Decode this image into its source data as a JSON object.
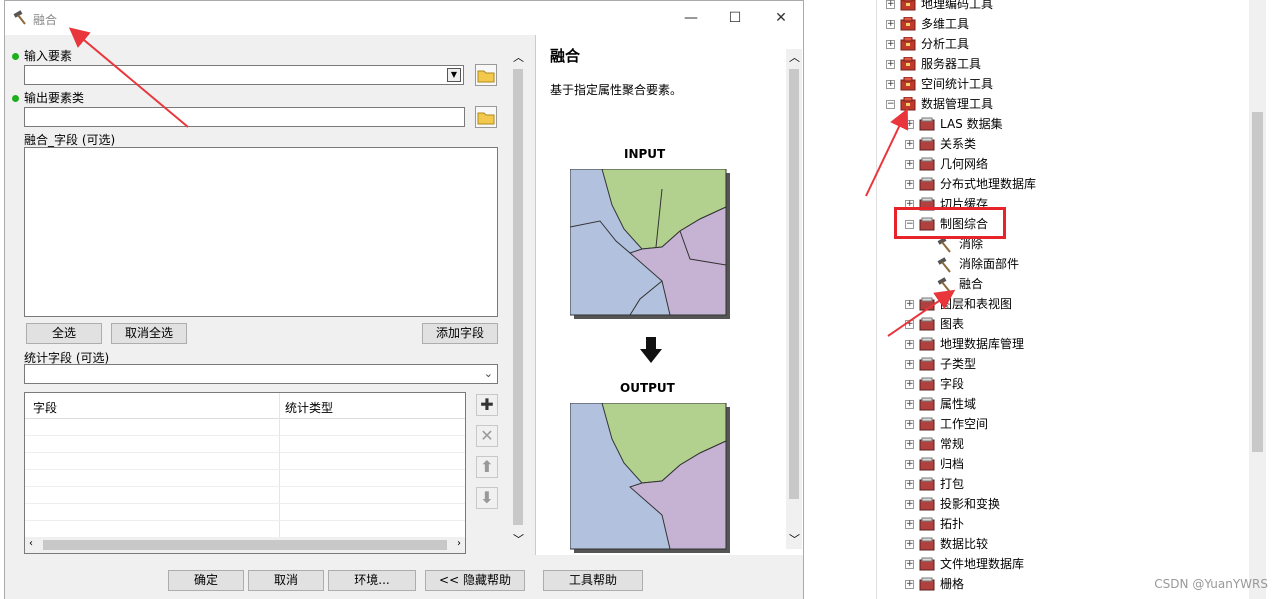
{
  "dialog": {
    "title": "融合",
    "controls": {
      "minimize": "—",
      "maximize": "☐",
      "close": "✕"
    },
    "input_features_label": "输入要素",
    "output_features_label": "输出要素类",
    "dissolve_field_label": "融合_字段 (可选)",
    "select_all": "全选",
    "clear_all": "取消全选",
    "add_field": "添加字段",
    "stat_field_label": "统计字段 (可选)",
    "stat_table": {
      "col_field": "字段",
      "col_stat_type": "统计类型"
    },
    "buttons": {
      "ok": "确定",
      "cancel": "取消",
      "env": "环境...",
      "hide_help": "<< 隐藏帮助",
      "tool_help": "工具帮助"
    }
  },
  "help": {
    "title": "融合",
    "description": "基于指定属性聚合要素。",
    "input_label": "INPUT",
    "output_label": "OUTPUT"
  },
  "colors": {
    "green": "#b3d18e",
    "blue": "#b2c1de",
    "purple": "#c6b3d4",
    "arrow": "#e8363c",
    "highlight": "#e8242b"
  },
  "tree": {
    "items": [
      {
        "label": "地理编码工具",
        "level": 0,
        "expander": "+",
        "icon": "toolbox-icon"
      },
      {
        "label": "多维工具",
        "level": 0,
        "expander": "+",
        "icon": "toolbox-icon"
      },
      {
        "label": "分析工具",
        "level": 0,
        "expander": "+",
        "icon": "toolbox-icon"
      },
      {
        "label": "服务器工具",
        "level": 0,
        "expander": "+",
        "icon": "toolbox-icon"
      },
      {
        "label": "空间统计工具",
        "level": 0,
        "expander": "+",
        "icon": "toolbox-icon"
      },
      {
        "label": "数据管理工具",
        "level": 0,
        "expander": "−",
        "icon": "toolbox-icon"
      },
      {
        "label": "LAS 数据集",
        "level": 1,
        "expander": "+",
        "icon": "toolset-icon"
      },
      {
        "label": "关系类",
        "level": 1,
        "expander": "+",
        "icon": "toolset-icon"
      },
      {
        "label": "几何网络",
        "level": 1,
        "expander": "+",
        "icon": "toolset-icon"
      },
      {
        "label": "分布式地理数据库",
        "level": 1,
        "expander": "+",
        "icon": "toolset-icon"
      },
      {
        "label": "切片缓存",
        "level": 1,
        "expander": "+",
        "icon": "toolset-icon"
      },
      {
        "label": "制图综合",
        "level": 1,
        "expander": "−",
        "icon": "toolset-icon"
      },
      {
        "label": "消除",
        "level": 2,
        "expander": "",
        "icon": "hammer-icon"
      },
      {
        "label": "消除面部件",
        "level": 2,
        "expander": "",
        "icon": "hammer-icon"
      },
      {
        "label": "融合",
        "level": 2,
        "expander": "",
        "icon": "hammer-icon"
      },
      {
        "label": "图层和表视图",
        "level": 1,
        "expander": "+",
        "icon": "toolset-icon"
      },
      {
        "label": "图表",
        "level": 1,
        "expander": "+",
        "icon": "toolset-icon"
      },
      {
        "label": "地理数据库管理",
        "level": 1,
        "expander": "+",
        "icon": "toolset-icon"
      },
      {
        "label": "子类型",
        "level": 1,
        "expander": "+",
        "icon": "toolset-icon"
      },
      {
        "label": "字段",
        "level": 1,
        "expander": "+",
        "icon": "toolset-icon"
      },
      {
        "label": "属性域",
        "level": 1,
        "expander": "+",
        "icon": "toolset-icon"
      },
      {
        "label": "工作空间",
        "level": 1,
        "expander": "+",
        "icon": "toolset-icon"
      },
      {
        "label": "常规",
        "level": 1,
        "expander": "+",
        "icon": "toolset-icon"
      },
      {
        "label": "归档",
        "level": 1,
        "expander": "+",
        "icon": "toolset-icon"
      },
      {
        "label": "打包",
        "level": 1,
        "expander": "+",
        "icon": "toolset-icon"
      },
      {
        "label": "投影和变换",
        "level": 1,
        "expander": "+",
        "icon": "toolset-icon"
      },
      {
        "label": "拓扑",
        "level": 1,
        "expander": "+",
        "icon": "toolset-icon"
      },
      {
        "label": "数据比较",
        "level": 1,
        "expander": "+",
        "icon": "toolset-icon"
      },
      {
        "label": "文件地理数据库",
        "level": 1,
        "expander": "+",
        "icon": "toolset-icon"
      },
      {
        "label": "栅格",
        "level": 1,
        "expander": "+",
        "icon": "toolset-icon"
      }
    ]
  },
  "watermark": "CSDN @YuanYWRS"
}
